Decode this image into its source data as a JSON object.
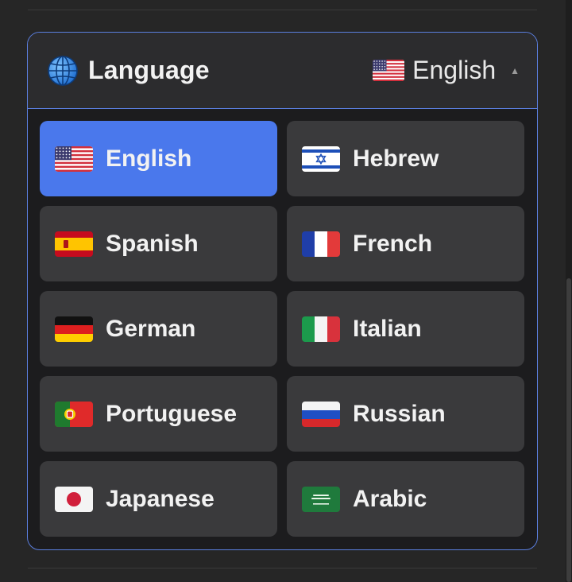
{
  "header": {
    "title": "Language",
    "globe_icon": "globe-icon",
    "current_language": "English",
    "current_flag": "us",
    "caret_icon": "caret-up-icon"
  },
  "colors": {
    "accent": "#4a78ec",
    "border": "#5b7fe0",
    "option_bg": "#3a3a3c"
  },
  "languages": [
    {
      "label": "English",
      "flag": "us",
      "selected": true
    },
    {
      "label": "Hebrew",
      "flag": "il",
      "selected": false
    },
    {
      "label": "Spanish",
      "flag": "es",
      "selected": false
    },
    {
      "label": "French",
      "flag": "fr",
      "selected": false
    },
    {
      "label": "German",
      "flag": "de",
      "selected": false
    },
    {
      "label": "Italian",
      "flag": "it",
      "selected": false
    },
    {
      "label": "Portuguese",
      "flag": "pt",
      "selected": false
    },
    {
      "label": "Russian",
      "flag": "ru",
      "selected": false
    },
    {
      "label": "Japanese",
      "flag": "jp",
      "selected": false
    },
    {
      "label": "Arabic",
      "flag": "sa",
      "selected": false
    }
  ]
}
